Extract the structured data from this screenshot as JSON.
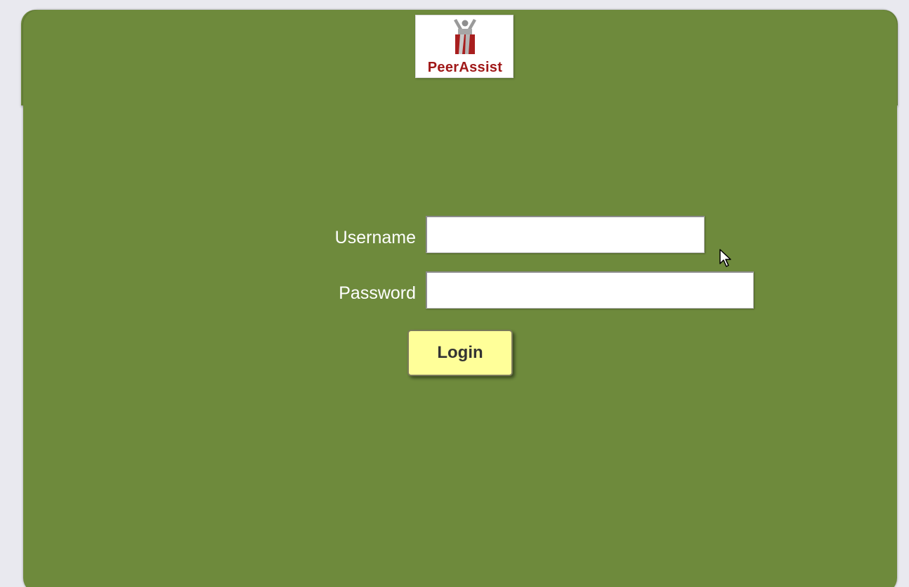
{
  "logo": {
    "text": "PeerAssist",
    "icon": "person-figure-logo-icon",
    "text_color": "#a01818"
  },
  "form": {
    "username_label": "Username",
    "username_value": "",
    "password_label": "Password",
    "password_value": "",
    "login_label": "Login"
  },
  "colors": {
    "background": "#e9e9ef",
    "panel": "#6e8a3c",
    "button": "#ffff99",
    "label_text": "#ffffff"
  },
  "pointer": {
    "icon": "mouse-pointer-icon"
  }
}
